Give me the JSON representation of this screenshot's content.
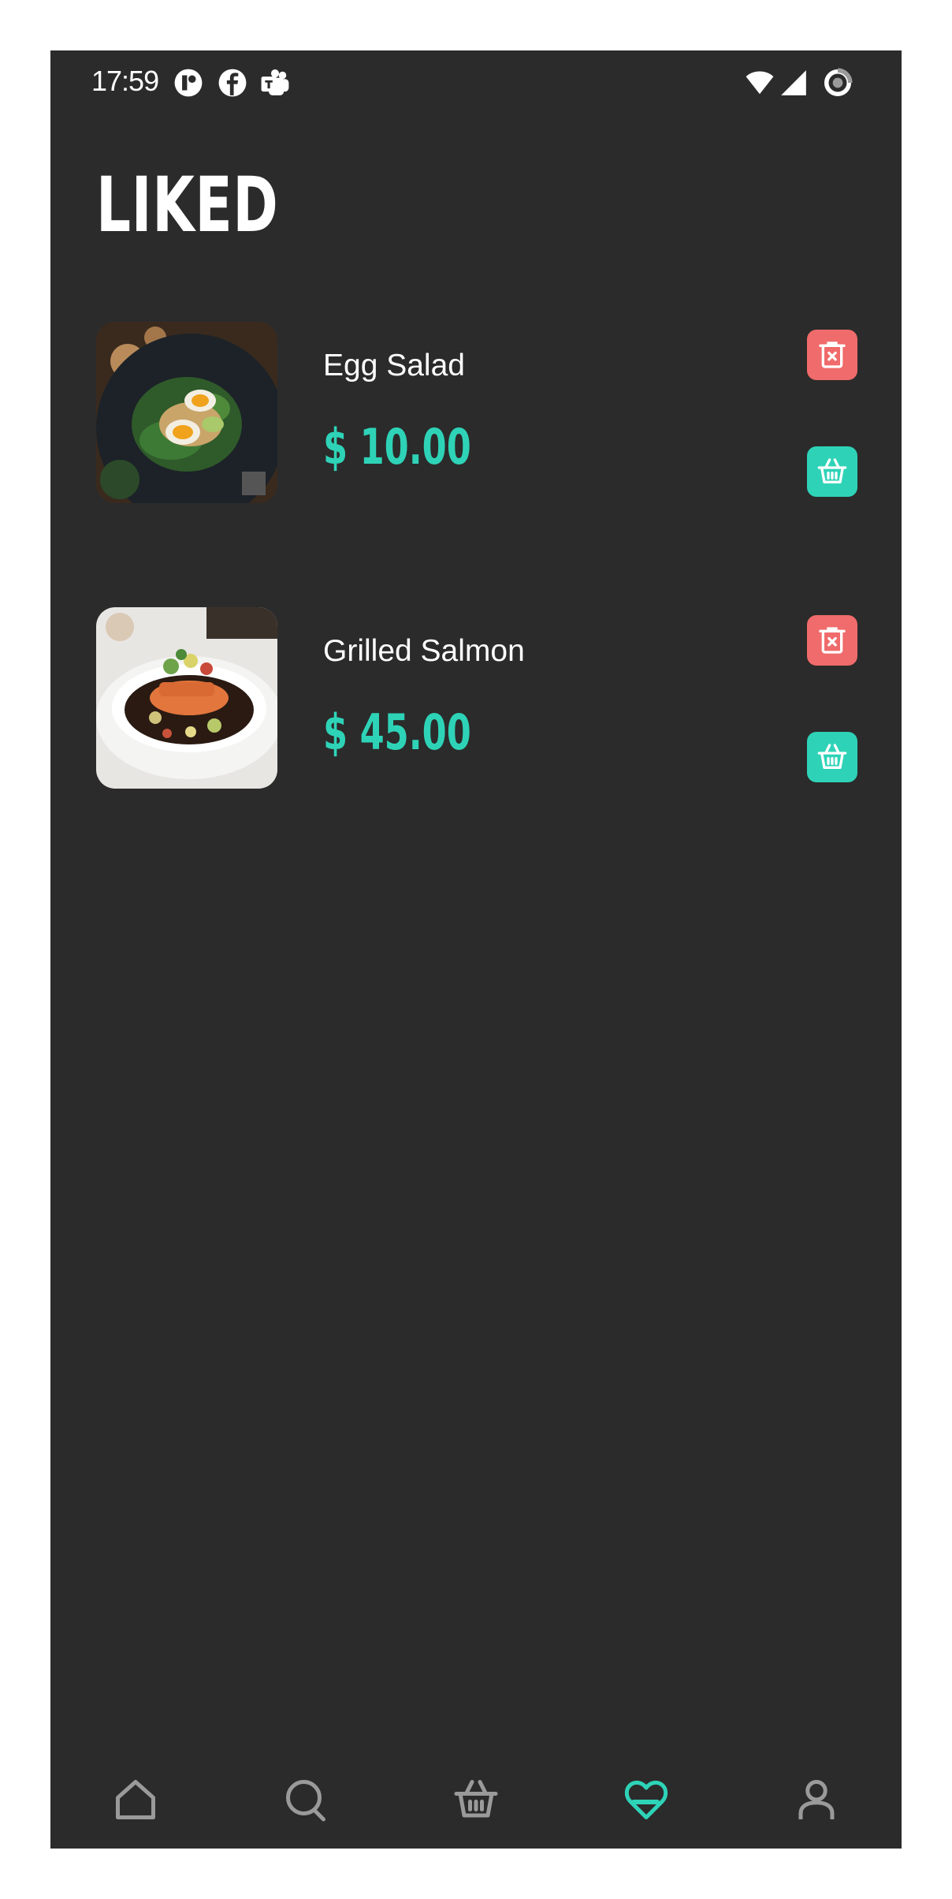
{
  "status_bar": {
    "time": "17:59",
    "icons": [
      "app-notification-icon",
      "facebook-icon",
      "teams-icon",
      "wifi-icon",
      "signal-icon",
      "data-saver-icon"
    ]
  },
  "page": {
    "title": "LIKED"
  },
  "liked_items": [
    {
      "name": "Egg Salad",
      "price": "$ 10.00",
      "image": "egg-salad-photo"
    },
    {
      "name": "Grilled Salmon",
      "price": "$ 45.00",
      "image": "grilled-salmon-photo"
    }
  ],
  "bottom_nav": {
    "items": [
      "home-icon",
      "search-icon",
      "basket-icon",
      "heart-icon",
      "profile-icon"
    ],
    "active": "heart-icon"
  },
  "colors": {
    "background": "#2b2b2b",
    "accent": "#2ed3b7",
    "delete": "#f06b6b",
    "inactive_icon": "#9a9a9a"
  }
}
